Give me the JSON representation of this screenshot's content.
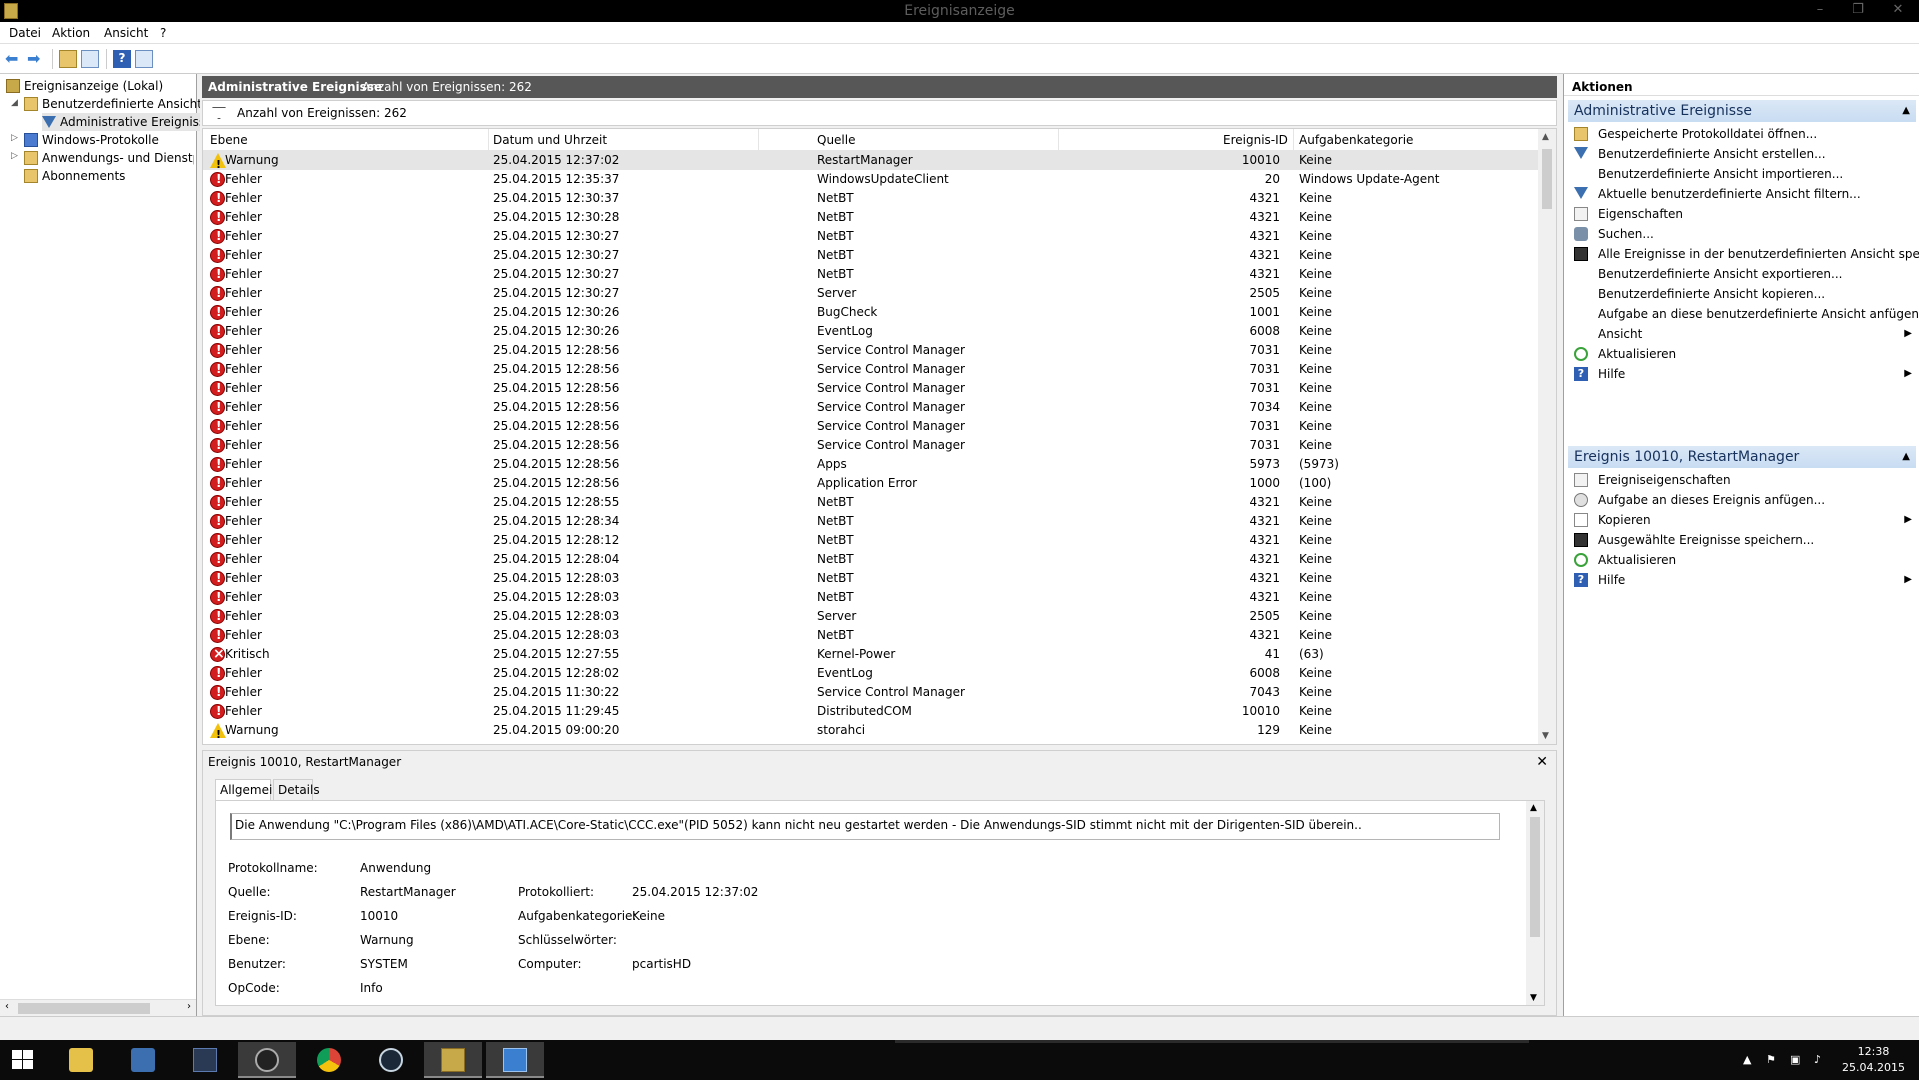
{
  "window": {
    "title": "Ereignisanzeige"
  },
  "menu": [
    "Datei",
    "Aktion",
    "Ansicht",
    "?"
  ],
  "tree": {
    "root": "Ereignisanzeige (Lokal)",
    "custom_views": "Benutzerdefinierte Ansichten",
    "admin_events": "Administrative Ereignisse",
    "windows_logs": "Windows-Protokolle",
    "app_logs": "Anwendungs- und Dienstprotokolle",
    "subscriptions": "Abonnements"
  },
  "middle": {
    "header_title": "Administrative Ereignisse",
    "header_count": "Anzahl von Ereignissen: 262",
    "filter_text": "Anzahl von Ereignissen: 262",
    "columns": [
      "Ebene",
      "Datum und Uhrzeit",
      "Quelle",
      "Ereignis-ID",
      "Aufgabenkategorie"
    ]
  },
  "events": [
    {
      "level": "Warnung",
      "type": "warn",
      "date": "25.04.2015 12:37:02",
      "source": "RestartManager",
      "id": "10010",
      "cat": "Keine"
    },
    {
      "level": "Fehler",
      "type": "err",
      "date": "25.04.2015 12:35:37",
      "source": "WindowsUpdateClient",
      "id": "20",
      "cat": "Windows Update-Agent"
    },
    {
      "level": "Fehler",
      "type": "err",
      "date": "25.04.2015 12:30:37",
      "source": "NetBT",
      "id": "4321",
      "cat": "Keine"
    },
    {
      "level": "Fehler",
      "type": "err",
      "date": "25.04.2015 12:30:28",
      "source": "NetBT",
      "id": "4321",
      "cat": "Keine"
    },
    {
      "level": "Fehler",
      "type": "err",
      "date": "25.04.2015 12:30:27",
      "source": "NetBT",
      "id": "4321",
      "cat": "Keine"
    },
    {
      "level": "Fehler",
      "type": "err",
      "date": "25.04.2015 12:30:27",
      "source": "NetBT",
      "id": "4321",
      "cat": "Keine"
    },
    {
      "level": "Fehler",
      "type": "err",
      "date": "25.04.2015 12:30:27",
      "source": "NetBT",
      "id": "4321",
      "cat": "Keine"
    },
    {
      "level": "Fehler",
      "type": "err",
      "date": "25.04.2015 12:30:27",
      "source": "Server",
      "id": "2505",
      "cat": "Keine"
    },
    {
      "level": "Fehler",
      "type": "err",
      "date": "25.04.2015 12:30:26",
      "source": "BugCheck",
      "id": "1001",
      "cat": "Keine"
    },
    {
      "level": "Fehler",
      "type": "err",
      "date": "25.04.2015 12:30:26",
      "source": "EventLog",
      "id": "6008",
      "cat": "Keine"
    },
    {
      "level": "Fehler",
      "type": "err",
      "date": "25.04.2015 12:28:56",
      "source": "Service Control Manager",
      "id": "7031",
      "cat": "Keine"
    },
    {
      "level": "Fehler",
      "type": "err",
      "date": "25.04.2015 12:28:56",
      "source": "Service Control Manager",
      "id": "7031",
      "cat": "Keine"
    },
    {
      "level": "Fehler",
      "type": "err",
      "date": "25.04.2015 12:28:56",
      "source": "Service Control Manager",
      "id": "7031",
      "cat": "Keine"
    },
    {
      "level": "Fehler",
      "type": "err",
      "date": "25.04.2015 12:28:56",
      "source": "Service Control Manager",
      "id": "7034",
      "cat": "Keine"
    },
    {
      "level": "Fehler",
      "type": "err",
      "date": "25.04.2015 12:28:56",
      "source": "Service Control Manager",
      "id": "7031",
      "cat": "Keine"
    },
    {
      "level": "Fehler",
      "type": "err",
      "date": "25.04.2015 12:28:56",
      "source": "Service Control Manager",
      "id": "7031",
      "cat": "Keine"
    },
    {
      "level": "Fehler",
      "type": "err",
      "date": "25.04.2015 12:28:56",
      "source": "Apps",
      "id": "5973",
      "cat": "(5973)"
    },
    {
      "level": "Fehler",
      "type": "err",
      "date": "25.04.2015 12:28:56",
      "source": "Application Error",
      "id": "1000",
      "cat": "(100)"
    },
    {
      "level": "Fehler",
      "type": "err",
      "date": "25.04.2015 12:28:55",
      "source": "NetBT",
      "id": "4321",
      "cat": "Keine"
    },
    {
      "level": "Fehler",
      "type": "err",
      "date": "25.04.2015 12:28:34",
      "source": "NetBT",
      "id": "4321",
      "cat": "Keine"
    },
    {
      "level": "Fehler",
      "type": "err",
      "date": "25.04.2015 12:28:12",
      "source": "NetBT",
      "id": "4321",
      "cat": "Keine"
    },
    {
      "level": "Fehler",
      "type": "err",
      "date": "25.04.2015 12:28:04",
      "source": "NetBT",
      "id": "4321",
      "cat": "Keine"
    },
    {
      "level": "Fehler",
      "type": "err",
      "date": "25.04.2015 12:28:03",
      "source": "NetBT",
      "id": "4321",
      "cat": "Keine"
    },
    {
      "level": "Fehler",
      "type": "err",
      "date": "25.04.2015 12:28:03",
      "source": "NetBT",
      "id": "4321",
      "cat": "Keine"
    },
    {
      "level": "Fehler",
      "type": "err",
      "date": "25.04.2015 12:28:03",
      "source": "Server",
      "id": "2505",
      "cat": "Keine"
    },
    {
      "level": "Fehler",
      "type": "err",
      "date": "25.04.2015 12:28:03",
      "source": "NetBT",
      "id": "4321",
      "cat": "Keine"
    },
    {
      "level": "Kritisch",
      "type": "crit",
      "date": "25.04.2015 12:27:55",
      "source": "Kernel-Power",
      "id": "41",
      "cat": "(63)"
    },
    {
      "level": "Fehler",
      "type": "err",
      "date": "25.04.2015 12:28:02",
      "source": "EventLog",
      "id": "6008",
      "cat": "Keine"
    },
    {
      "level": "Fehler",
      "type": "err",
      "date": "25.04.2015 11:30:22",
      "source": "Service Control Manager",
      "id": "7043",
      "cat": "Keine"
    },
    {
      "level": "Fehler",
      "type": "err",
      "date": "25.04.2015 11:29:45",
      "source": "DistributedCOM",
      "id": "10010",
      "cat": "Keine"
    },
    {
      "level": "Warnung",
      "type": "warn",
      "date": "25.04.2015 09:00:20",
      "source": "storahci",
      "id": "129",
      "cat": "Keine"
    }
  ],
  "details": {
    "title": "Ereignis 10010, RestartManager",
    "tab_general": "Allgemein",
    "tab_details": "Details",
    "message": "Die Anwendung \"C:\\Program Files (x86)\\AMD\\ATI.ACE\\Core-Static\\CCC.exe\"(PID 5052) kann  nicht neu gestartet werden - Die Anwendungs-SID stimmt nicht mit der Dirigenten-SID überein..",
    "labels": {
      "logname": "Protokollname:",
      "source": "Quelle:",
      "eventid": "Ereignis-ID:",
      "level": "Ebene:",
      "user": "Benutzer:",
      "opcode": "OpCode:",
      "logged": "Protokolliert:",
      "taskcat": "Aufgabenkategorie:",
      "keywords": "Schlüsselwörter:",
      "computer": "Computer:"
    },
    "values": {
      "logname": "Anwendung",
      "source": "RestartManager",
      "eventid": "10010",
      "level": "Warnung",
      "user": "SYSTEM",
      "opcode": "Info",
      "logged": "25.04.2015 12:37:02",
      "taskcat": "Keine",
      "keywords": "",
      "computer": "pcartisHD"
    }
  },
  "actions": {
    "header": "Aktionen",
    "section1": "Administrative Ereignisse",
    "section1_items": [
      {
        "label": "Gespeicherte Protokolldatei öffnen...",
        "icon": "folder",
        "sub": false
      },
      {
        "label": "Benutzerdefinierte Ansicht erstellen...",
        "icon": "filt",
        "sub": false
      },
      {
        "label": "Benutzerdefinierte Ansicht importieren...",
        "icon": "none",
        "sub": false
      },
      {
        "label": "Aktuelle benutzerdefinierte Ansicht filtern...",
        "icon": "filt",
        "sub": false
      },
      {
        "label": "Eigenschaften",
        "icon": "prop",
        "sub": false
      },
      {
        "label": "Suchen...",
        "icon": "find",
        "sub": false
      },
      {
        "label": "Alle Ereignisse in der benutzerdefinierten Ansicht speic...",
        "icon": "save",
        "sub": false
      },
      {
        "label": "Benutzerdefinierte Ansicht exportieren...",
        "icon": "none",
        "sub": false
      },
      {
        "label": "Benutzerdefinierte Ansicht kopieren...",
        "icon": "none",
        "sub": false
      },
      {
        "label": "Aufgabe an diese benutzerdefinierte Ansicht anfügen...",
        "icon": "none",
        "sub": false
      },
      {
        "label": "Ansicht",
        "icon": "none",
        "sub": true
      },
      {
        "label": "Aktualisieren",
        "icon": "refresh",
        "sub": false
      },
      {
        "label": "Hilfe",
        "icon": "help",
        "sub": true
      }
    ],
    "section2": "Ereignis 10010, RestartManager",
    "section2_items": [
      {
        "label": "Ereigniseigenschaften",
        "icon": "prop",
        "sub": false
      },
      {
        "label": "Aufgabe an dieses Ereignis anfügen...",
        "icon": "task",
        "sub": false
      },
      {
        "label": "Kopieren",
        "icon": "copy",
        "sub": true
      },
      {
        "label": "Ausgewählte Ereignisse speichern...",
        "icon": "save",
        "sub": false
      },
      {
        "label": "Aktualisieren",
        "icon": "refresh",
        "sub": false
      },
      {
        "label": "Hilfe",
        "icon": "help",
        "sub": true
      }
    ]
  },
  "taskbar": {
    "clock_time": "12:38",
    "clock_date": "25.04.2015"
  }
}
